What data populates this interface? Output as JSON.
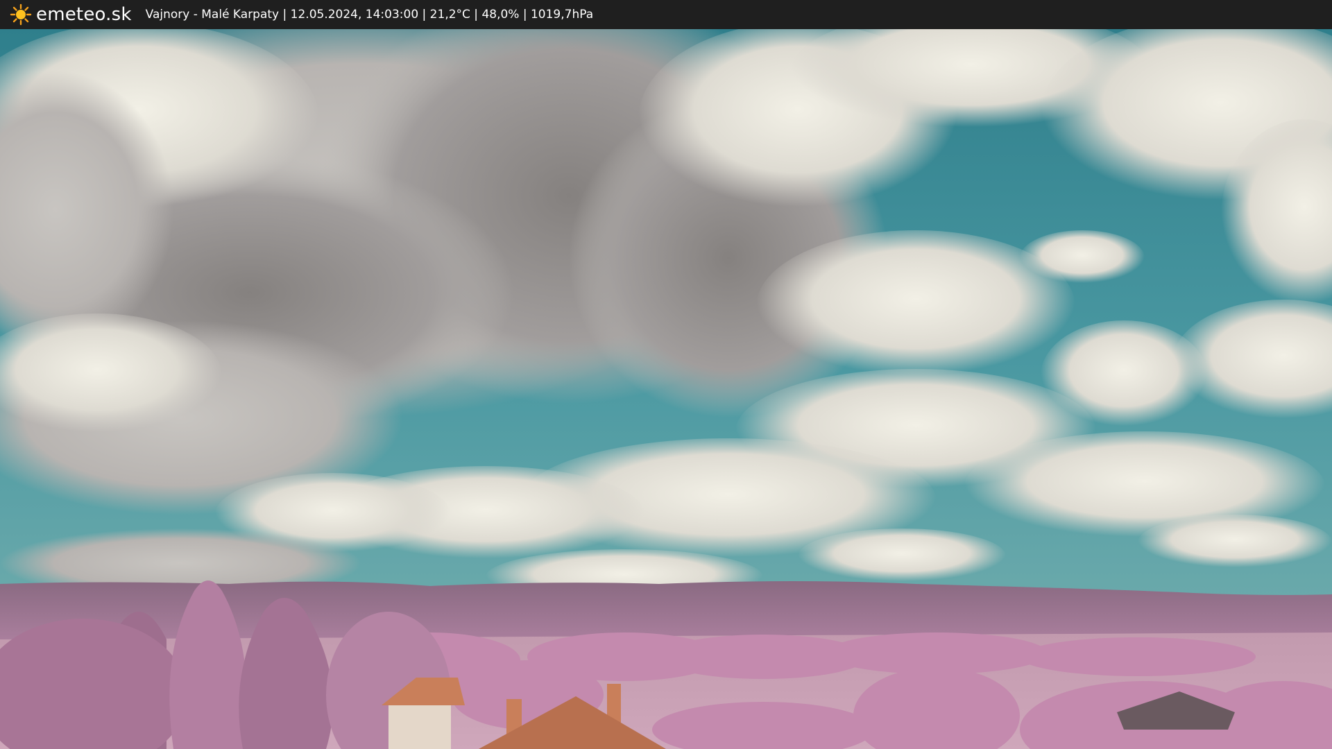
{
  "header": {
    "brand": "emeteo.sk",
    "logo_icon": "sun-icon",
    "info": "Vajnory - Malé Karpaty | 12.05.2024, 14:03:00 | 21,2°C | 48,0% | 1019,7hPa"
  },
  "image": {
    "subject": "webcam-view"
  },
  "colors": {
    "bar": "#1f1f1f",
    "sky": "#3f8f9a",
    "foliage": "#c98fb4",
    "roof": "#c97f5a"
  }
}
